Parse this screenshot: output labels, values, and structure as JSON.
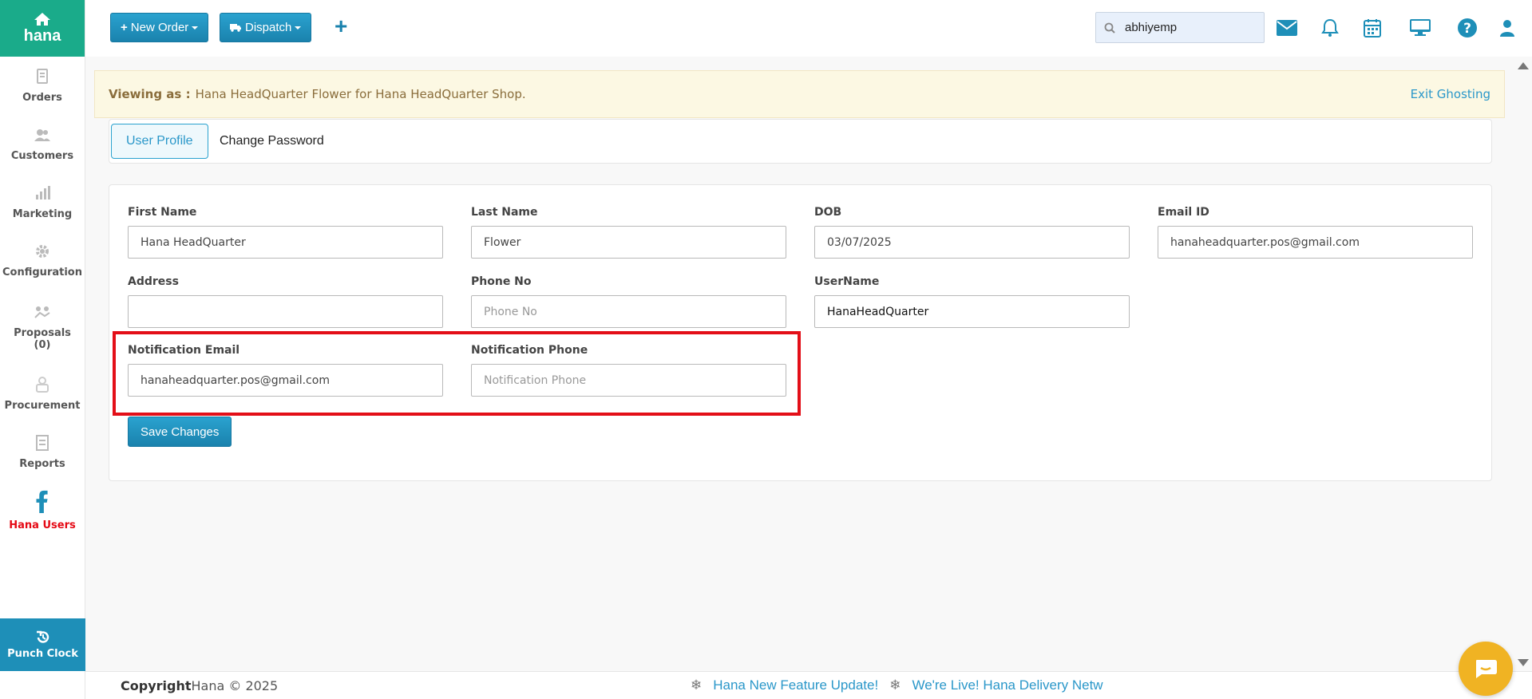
{
  "brand": {
    "logo_text": "hana",
    "primary_color": "#1aab8a",
    "accent_color": "#2a97c9",
    "highlight_color": "#e30f18"
  },
  "sidebar": {
    "items": [
      {
        "label": "Orders",
        "icon": "orders-icon"
      },
      {
        "label": "Customers",
        "icon": "customers-icon"
      },
      {
        "label": "Marketing",
        "icon": "marketing-icon"
      },
      {
        "label": "Configuration",
        "icon": "gear-icon"
      },
      {
        "label": "Proposals",
        "count": "(0)",
        "icon": "proposals-icon"
      },
      {
        "label": "Procurement",
        "icon": "procurement-icon"
      },
      {
        "label": "Reports",
        "icon": "reports-icon"
      },
      {
        "label": "Hana Users",
        "icon": "facebook-icon",
        "active": true
      }
    ],
    "punch_clock_label": "Punch Clock"
  },
  "topbar": {
    "new_order_label": "New Order",
    "dispatch_label": "Dispatch",
    "add_icon": "plus-icon",
    "search_value": "abhiyemp",
    "icons": [
      "mail-icon",
      "bell-icon",
      "calendar-icon",
      "monitor-icon",
      "help-icon",
      "user-icon"
    ]
  },
  "alert": {
    "prefix": "Viewing as :",
    "message": "Hana HeadQuarter Flower for Hana HeadQuarter Shop.",
    "exit_label": "Exit Ghosting"
  },
  "tabs": [
    {
      "label": "User Profile",
      "active": true
    },
    {
      "label": "Change Password",
      "active": false
    }
  ],
  "form": {
    "first_name": {
      "label": "First Name",
      "value": "Hana HeadQuarter",
      "placeholder": ""
    },
    "last_name": {
      "label": "Last Name",
      "value": "Flower",
      "placeholder": ""
    },
    "dob": {
      "label": "DOB",
      "value": "03/07/2025",
      "placeholder": ""
    },
    "email": {
      "label": "Email ID",
      "value": "hanaheadquarter.pos@gmail.com",
      "placeholder": ""
    },
    "address": {
      "label": "Address",
      "value": "",
      "placeholder": ""
    },
    "phone": {
      "label": "Phone No",
      "value": "",
      "placeholder": "Phone No"
    },
    "username": {
      "label": "UserName",
      "value": "HanaHeadQuarter",
      "placeholder": ""
    },
    "notification_email": {
      "label": "Notification Email",
      "value": "hanaheadquarter.pos@gmail.com",
      "placeholder": ""
    },
    "notification_phone": {
      "label": "Notification Phone",
      "value": "",
      "placeholder": "Notification Phone"
    },
    "save_label": "Save Changes"
  },
  "footer": {
    "copyright_bold": "Copyright",
    "copyright_rest": "Hana © 2025",
    "ticker": [
      "Hana New Feature Update!",
      "We're Live! Hana Delivery Netw"
    ]
  }
}
